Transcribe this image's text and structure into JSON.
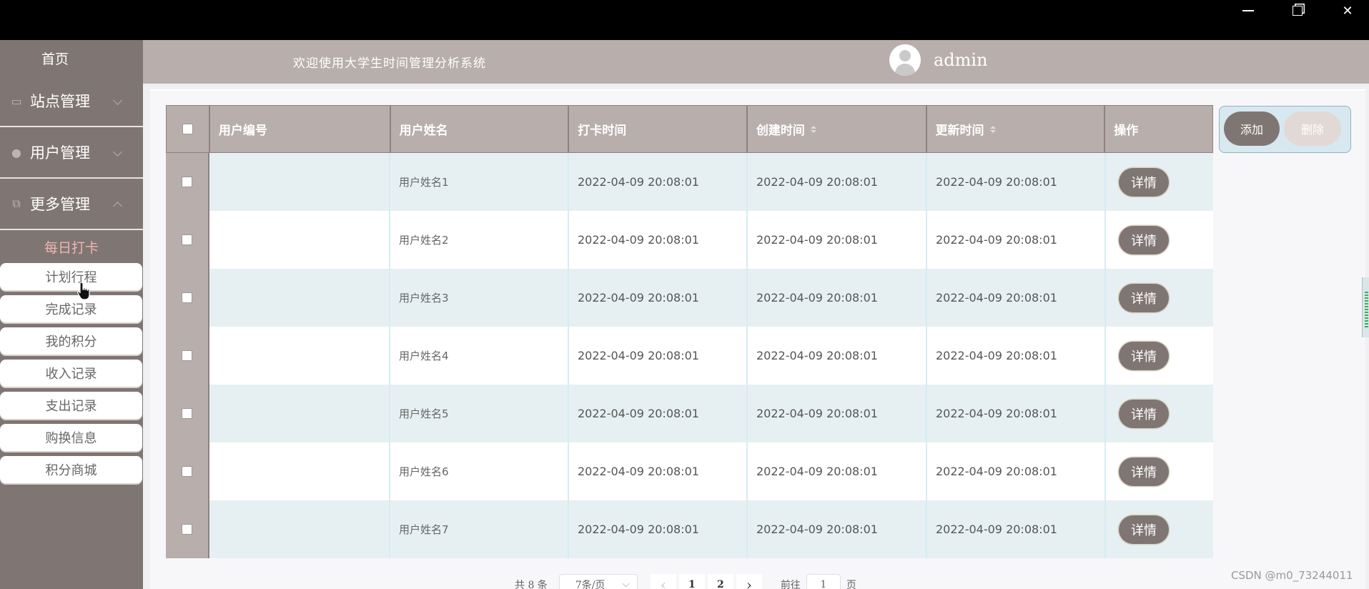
{
  "window": {
    "min_icon": "minimize-icon",
    "max_icon": "restore-icon",
    "close_icon": "close-icon",
    "close_glyph": "✕"
  },
  "sidebar": {
    "home": "首页",
    "groups": [
      {
        "label": "站点管理",
        "icon": "monitor-icon",
        "glyph": "▭"
      },
      {
        "label": "用户管理",
        "icon": "user-icon",
        "glyph": "●"
      },
      {
        "label": "更多管理",
        "icon": "copy-icon",
        "glyph": "⧉"
      }
    ],
    "active_sub": "每日打卡",
    "sub_items": [
      "计划行程",
      "完成记录",
      "我的积分",
      "收入记录",
      "支出记录",
      "购换信息",
      "积分商城"
    ]
  },
  "header": {
    "welcome": "欢迎使用大学生时间管理分析系统",
    "username": "admin"
  },
  "table": {
    "columns": [
      "用户编号",
      "用户姓名",
      "打卡时间",
      "创建时间",
      "更新时间",
      "操作"
    ],
    "detail_label": "详情",
    "rows": [
      {
        "id": "",
        "name": "用户姓名1",
        "punch": "2022-04-09 20:08:01",
        "created": "2022-04-09 20:08:01",
        "updated": "2022-04-09 20:08:01"
      },
      {
        "id": "",
        "name": "用户姓名2",
        "punch": "2022-04-09 20:08:01",
        "created": "2022-04-09 20:08:01",
        "updated": "2022-04-09 20:08:01"
      },
      {
        "id": "",
        "name": "用户姓名3",
        "punch": "2022-04-09 20:08:01",
        "created": "2022-04-09 20:08:01",
        "updated": "2022-04-09 20:08:01"
      },
      {
        "id": "",
        "name": "用户姓名4",
        "punch": "2022-04-09 20:08:01",
        "created": "2022-04-09 20:08:01",
        "updated": "2022-04-09 20:08:01"
      },
      {
        "id": "",
        "name": "用户姓名5",
        "punch": "2022-04-09 20:08:01",
        "created": "2022-04-09 20:08:01",
        "updated": "2022-04-09 20:08:01"
      },
      {
        "id": "",
        "name": "用户姓名6",
        "punch": "2022-04-09 20:08:01",
        "created": "2022-04-09 20:08:01",
        "updated": "2022-04-09 20:08:01"
      },
      {
        "id": "",
        "name": "用户姓名7",
        "punch": "2022-04-09 20:08:01",
        "created": "2022-04-09 20:08:01",
        "updated": "2022-04-09 20:08:01"
      }
    ]
  },
  "actions": {
    "add": "添加",
    "delete": "删除"
  },
  "pager": {
    "total": "共 8 条",
    "page_size": "7条/页",
    "pages": [
      "1",
      "2"
    ],
    "goto": "前往",
    "current": "1",
    "page_unit": "页",
    "prev_glyph": "‹",
    "next_glyph": "›"
  },
  "watermark": "CSDN @m0_73244011",
  "colors": {
    "sidebar": "#7f7673",
    "header": "#b8aeab",
    "active_sub": "#f2b4b4",
    "row_alt": "#e6f0f2"
  }
}
